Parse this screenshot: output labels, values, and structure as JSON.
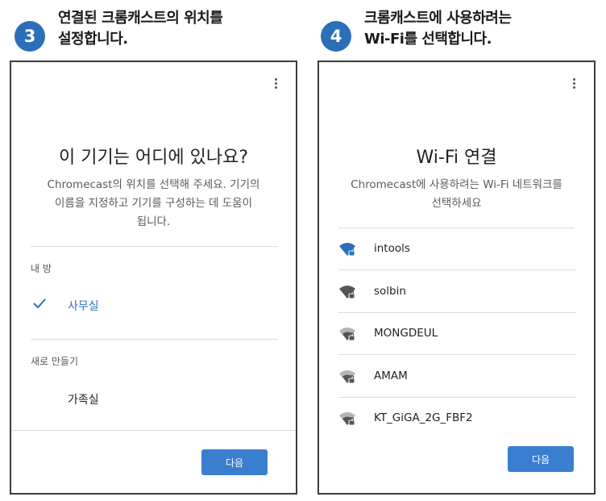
{
  "step3": {
    "number": "3",
    "title_line1": "연결된 크롬캐스트의 위치를",
    "title_line2": "설정합니다.",
    "screen_title": "이 기기는 어디에 있나요?",
    "desc_line1": "Chromecast의 위치를 선택해 주세요. 기기의",
    "desc_line2": "이름을 지정하고 기기를 구성하는 데 도움이",
    "desc_line3": "됩니다.",
    "section_my_room": "내 방",
    "selected_room": "사무실",
    "section_new": "새로 만들기",
    "new_room": "가족실",
    "next_label": "다음"
  },
  "step4": {
    "number": "4",
    "title_line1": "크롬캐스트에 사용하려는",
    "title_line2": "Wi-Fi를 선택합니다.",
    "screen_title": "Wi-Fi 연결",
    "desc_line1": "Chromecast에 사용하려는 Wi-Fi 네트워크를",
    "desc_line2": "선택하세요",
    "networks": [
      "intools",
      "solbin",
      "MONGDEUL",
      "AMAM",
      "KT_GiGA_2G_FBF2"
    ],
    "next_label": "다음"
  },
  "colors": {
    "accent": "#2c6fb8",
    "button": "#3a7ed0",
    "border": "#3d3d3d"
  }
}
